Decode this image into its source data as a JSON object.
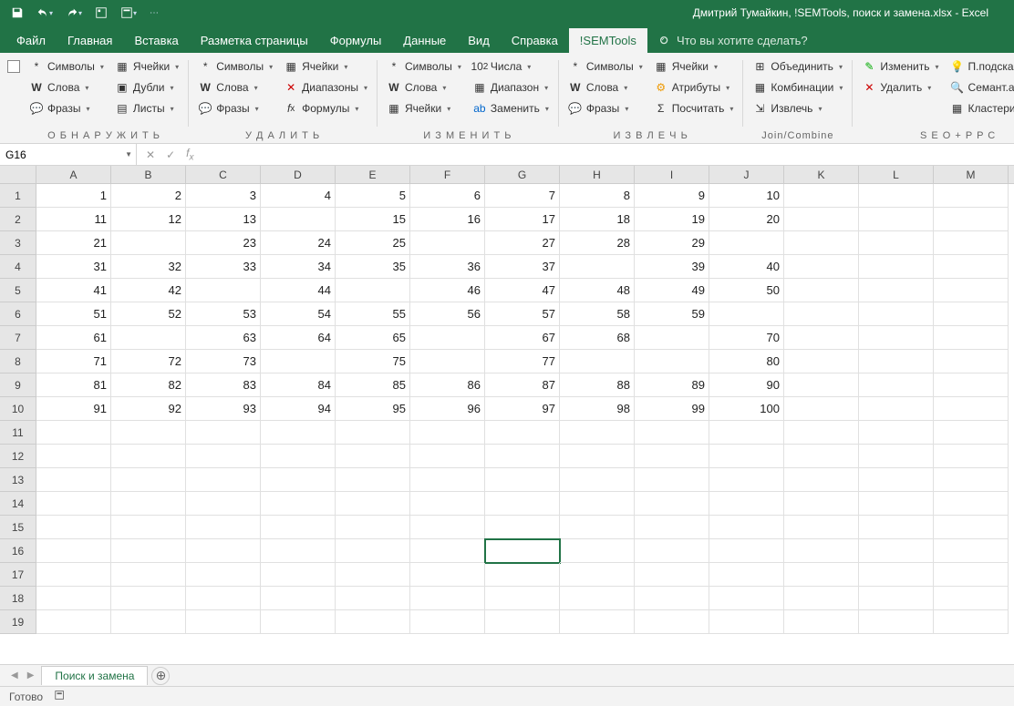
{
  "title": "Дмитрий Тумайкин, !SEMTools, поиск и замена.xlsx  -  Excel",
  "tabs": [
    "Файл",
    "Главная",
    "Вставка",
    "Разметка страницы",
    "Формулы",
    "Данные",
    "Вид",
    "Справка",
    "!SEMTools"
  ],
  "active_tab": "!SEMTools",
  "tell_me": "Что вы хотите сделать?",
  "ribbon": {
    "groups": [
      {
        "label": "О Б Н А Р У Ж И Т Ь",
        "cols": [
          [
            "Символы",
            "Слова",
            "Фразы"
          ],
          [
            "Ячейки",
            "Дубли",
            "Листы"
          ]
        ]
      },
      {
        "label": "У Д А Л И Т Ь",
        "cols": [
          [
            "Символы",
            "Слова",
            "Фразы"
          ],
          [
            "Ячейки",
            "Диапазоны",
            "Формулы"
          ]
        ]
      },
      {
        "label": "И З М Е Н И Т Ь",
        "cols": [
          [
            "Символы",
            "Слова",
            "Ячейки"
          ],
          [
            "Числа",
            "Диапазон",
            "Заменить"
          ]
        ]
      },
      {
        "label": "И З В Л Е Ч Ь",
        "cols": [
          [
            "Символы",
            "Слова",
            "Фразы"
          ],
          [
            "Ячейки",
            "Атрибуты",
            "Посчитать"
          ]
        ]
      },
      {
        "label": "Join/Combine",
        "cols": [
          [
            "Объединить",
            "Комбинации",
            "Извлечь"
          ]
        ]
      },
      {
        "label": "S E O + P P C",
        "cols": [
          [
            "Изменить",
            "Удалить",
            ""
          ],
          [
            "П.подсказки",
            "Семант.анализ",
            "Кластеризация"
          ]
        ]
      }
    ]
  },
  "name_box": "G16",
  "columns": [
    "A",
    "B",
    "C",
    "D",
    "E",
    "F",
    "G",
    "H",
    "I",
    "J",
    "K",
    "L",
    "M"
  ],
  "rows_count": 19,
  "active_cell": {
    "row": 16,
    "col": 7
  },
  "chart_data": {
    "type": "table",
    "columns": [
      "A",
      "B",
      "C",
      "D",
      "E",
      "F",
      "G",
      "H",
      "I",
      "J"
    ],
    "data": [
      [
        1,
        2,
        3,
        4,
        5,
        6,
        7,
        8,
        9,
        10
      ],
      [
        11,
        12,
        13,
        null,
        15,
        16,
        17,
        18,
        19,
        20
      ],
      [
        21,
        null,
        23,
        24,
        25,
        null,
        27,
        28,
        29,
        null
      ],
      [
        31,
        32,
        33,
        34,
        35,
        36,
        37,
        null,
        39,
        40
      ],
      [
        41,
        42,
        null,
        44,
        null,
        46,
        47,
        48,
        49,
        50
      ],
      [
        51,
        52,
        53,
        54,
        55,
        56,
        57,
        58,
        59,
        null
      ],
      [
        61,
        null,
        63,
        64,
        65,
        null,
        67,
        68,
        null,
        70
      ],
      [
        71,
        72,
        73,
        null,
        75,
        null,
        77,
        null,
        null,
        80
      ],
      [
        81,
        82,
        83,
        84,
        85,
        86,
        87,
        88,
        89,
        90
      ],
      [
        91,
        92,
        93,
        94,
        95,
        96,
        97,
        98,
        99,
        100
      ]
    ]
  },
  "sheet_tab": "Поиск и замена",
  "status": "Готово",
  "icons": {
    "symbols": "*",
    "words": "W",
    "phrases": "💬",
    "cells": "▦",
    "dupes": "▣",
    "sheets": "▤",
    "ranges": "✕",
    "formulas": "fx",
    "numbers": "10²",
    "replace": "ab→",
    "attrs": "⚙",
    "count": "Σ",
    "merge": "⊞",
    "comb": "▦",
    "extract": "⇲",
    "edit": "✎",
    "del": "✕",
    "hints": "💡",
    "semant": "🔍",
    "cluster": "▦"
  }
}
